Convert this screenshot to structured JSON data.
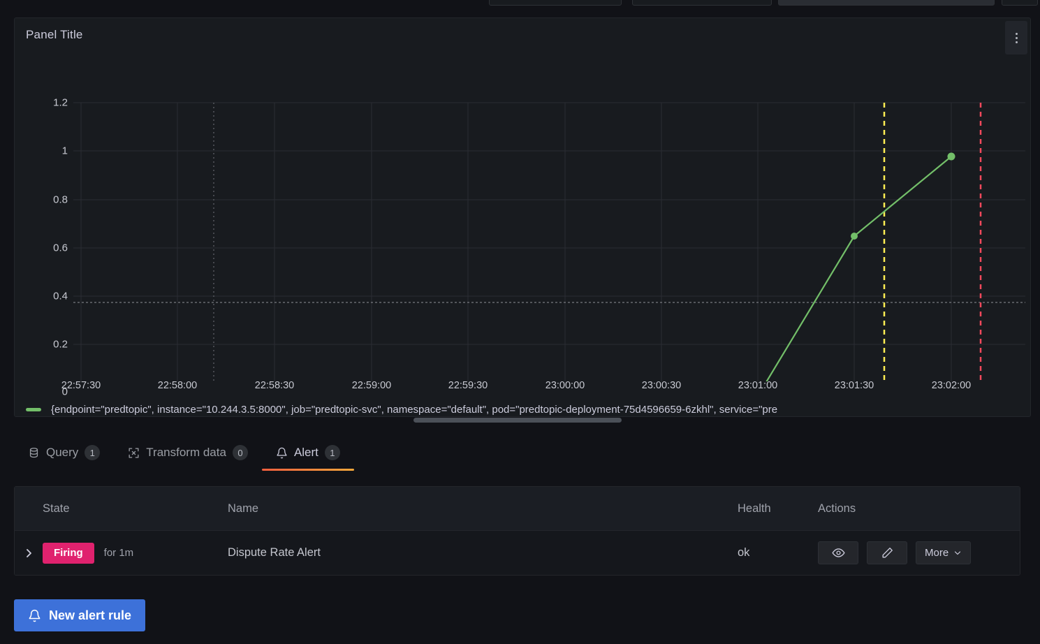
{
  "panel": {
    "title": "Panel Title",
    "menu_icon": "kebab-menu-icon"
  },
  "chart_data": {
    "type": "line",
    "title": "Panel Title",
    "xlabel": "",
    "ylabel": "",
    "grid": true,
    "legend_position": "bottom",
    "ylim": [
      0,
      1.2
    ],
    "yticks": [
      "0",
      "0.2",
      "0.4",
      "0.6",
      "0.8",
      "1",
      "1.2"
    ],
    "ytick_values": [
      0,
      0.2,
      0.4,
      0.6,
      0.8,
      1,
      1.2
    ],
    "xticks": [
      "22:57:30",
      "22:58:00",
      "22:58:30",
      "22:59:00",
      "22:59:30",
      "23:00:00",
      "23:00:30",
      "23:01:00",
      "23:01:30",
      "23:02:00"
    ],
    "xlim": [
      "22:57:30",
      "23:02:15"
    ],
    "series": [
      {
        "name": "{endpoint=\"predtopic\", instance=\"10.244.3.5:8000\", job=\"predtopic-svc\", namespace=\"default\", pod=\"predtopic-deployment-75d4596659-6zkhl\", service=\"pre",
        "color": "#73bf69",
        "x": [
          "22:57:30",
          "22:58:00",
          "22:58:30",
          "22:59:00",
          "22:59:30",
          "23:00:00",
          "23:00:30",
          "23:01:00",
          "23:01:30",
          "23:02:00"
        ],
        "values": [
          0,
          0,
          0,
          0,
          0.02,
          0.02,
          0.02,
          0.04,
          0.72,
          1.05
        ]
      }
    ],
    "threshold_line": {
      "value": 0.37,
      "color": "#8e9097",
      "style": "dashed"
    },
    "annotations": [
      {
        "time": "23:01:37",
        "color": "#ffee52",
        "style": "dashed",
        "marker": "triangle-up"
      },
      {
        "time": "23:02:10",
        "color": "#f2495c",
        "style": "dashed",
        "marker": "triangle-up"
      },
      {
        "time": "22:58:15",
        "color": "#55585e",
        "style": "dotted",
        "marker": "none"
      }
    ]
  },
  "legend": {
    "label": "{endpoint=\"predtopic\", instance=\"10.244.3.5:8000\", job=\"predtopic-svc\", namespace=\"default\", pod=\"predtopic-deployment-75d4596659-6zkhl\", service=\"pre",
    "swatch_color": "#73bf69"
  },
  "tabs": [
    {
      "label": "Query",
      "count": "1",
      "icon": "database-icon",
      "active": false
    },
    {
      "label": "Transform data",
      "count": "0",
      "icon": "transform-icon",
      "active": false
    },
    {
      "label": "Alert",
      "count": "1",
      "icon": "bell-icon",
      "active": true
    }
  ],
  "alert_table": {
    "columns": [
      "State",
      "Name",
      "Health",
      "Actions"
    ],
    "rows": [
      {
        "expand_icon": "chevron-right-icon",
        "state": "Firing",
        "state_color": "#e0226e",
        "for": "for 1m",
        "name": "Dispute Rate Alert",
        "health": "ok",
        "actions": {
          "view_icon": "eye-icon",
          "edit_icon": "pencil-icon",
          "more_label": "More",
          "more_chevron_icon": "chevron-down-icon"
        }
      }
    ]
  },
  "footer": {
    "new_alert_rule_label": "New alert rule",
    "new_alert_rule_icon": "bell-icon",
    "accent_color": "#3d71d9"
  }
}
